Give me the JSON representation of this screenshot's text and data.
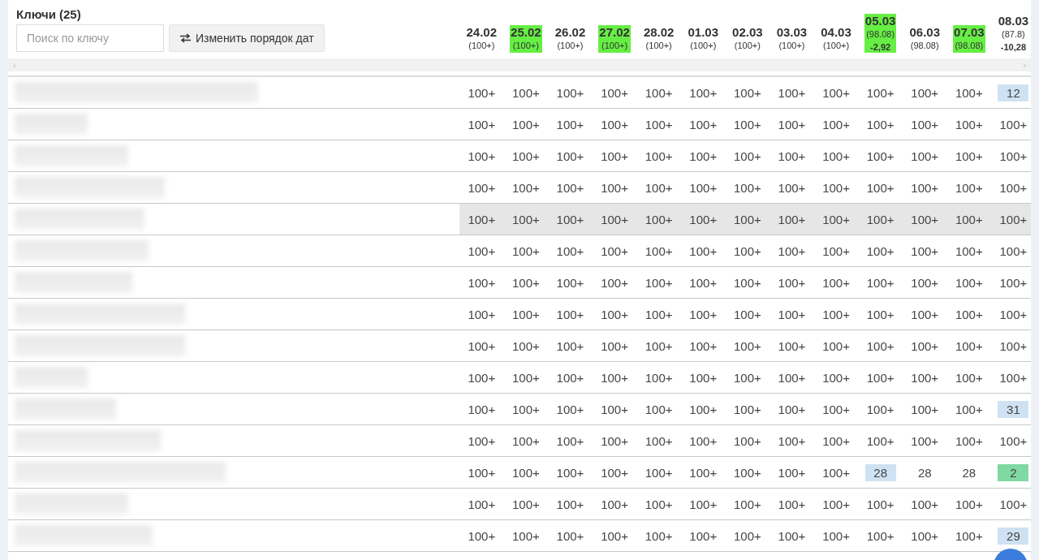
{
  "keys_panel": {
    "title": "Ключи (25)",
    "search": {
      "placeholder": "Поиск по ключу"
    },
    "reorder_button": {
      "label": "Изменить порядок дат"
    }
  },
  "dates": [
    {
      "date": "24.02",
      "sub": "(100+)",
      "highlighted": false
    },
    {
      "date": "25.02",
      "sub": "(100+)",
      "highlighted": true
    },
    {
      "date": "26.02",
      "sub": "(100+)",
      "highlighted": false
    },
    {
      "date": "27.02",
      "sub": "(100+)",
      "highlighted": true
    },
    {
      "date": "28.02",
      "sub": "(100+)",
      "highlighted": false
    },
    {
      "date": "01.03",
      "sub": "(100+)",
      "highlighted": false
    },
    {
      "date": "02.03",
      "sub": "(100+)",
      "highlighted": false
    },
    {
      "date": "03.03",
      "sub": "(100+)",
      "highlighted": false
    },
    {
      "date": "04.03",
      "sub": "(100+)",
      "highlighted": false
    },
    {
      "date": "05.03",
      "sub": "(98.08)",
      "delta": "-2,92",
      "highlighted": true
    },
    {
      "date": "06.03",
      "sub": "(98.08)",
      "highlighted": false
    },
    {
      "date": "07.03",
      "sub": "(98.08)",
      "highlighted": true
    },
    {
      "date": "08.03",
      "sub": "(87.8)",
      "delta": "-10,28",
      "highlighted": false
    }
  ],
  "scrollbar": {
    "left": "‹",
    "right": "›"
  },
  "rows": [
    {
      "hovered": false,
      "cells": [
        "100+",
        "100+",
        "100+",
        "100+",
        "100+",
        "100+",
        "100+",
        "100+",
        "100+",
        "100+",
        "100+",
        "100+",
        {
          "value": "12",
          "color": "#cfe2f3"
        }
      ]
    },
    {
      "hovered": false,
      "cells": [
        "100+",
        "100+",
        "100+",
        "100+",
        "100+",
        "100+",
        "100+",
        "100+",
        "100+",
        "100+",
        "100+",
        "100+",
        "100+"
      ]
    },
    {
      "hovered": false,
      "cells": [
        "100+",
        "100+",
        "100+",
        "100+",
        "100+",
        "100+",
        "100+",
        "100+",
        "100+",
        "100+",
        "100+",
        "100+",
        "100+"
      ]
    },
    {
      "hovered": false,
      "cells": [
        "100+",
        "100+",
        "100+",
        "100+",
        "100+",
        "100+",
        "100+",
        "100+",
        "100+",
        "100+",
        "100+",
        "100+",
        "100+"
      ]
    },
    {
      "hovered": true,
      "cells": [
        "100+",
        "100+",
        "100+",
        "100+",
        "100+",
        "100+",
        "100+",
        "100+",
        "100+",
        "100+",
        "100+",
        "100+",
        "100+"
      ]
    },
    {
      "hovered": false,
      "cells": [
        "100+",
        "100+",
        "100+",
        "100+",
        "100+",
        "100+",
        "100+",
        "100+",
        "100+",
        "100+",
        "100+",
        "100+",
        "100+"
      ]
    },
    {
      "hovered": false,
      "cells": [
        "100+",
        "100+",
        "100+",
        "100+",
        "100+",
        "100+",
        "100+",
        "100+",
        "100+",
        "100+",
        "100+",
        "100+",
        "100+"
      ]
    },
    {
      "hovered": false,
      "cells": [
        "100+",
        "100+",
        "100+",
        "100+",
        "100+",
        "100+",
        "100+",
        "100+",
        "100+",
        "100+",
        "100+",
        "100+",
        "100+"
      ]
    },
    {
      "hovered": false,
      "cells": [
        "100+",
        "100+",
        "100+",
        "100+",
        "100+",
        "100+",
        "100+",
        "100+",
        "100+",
        "100+",
        "100+",
        "100+",
        "100+"
      ]
    },
    {
      "hovered": false,
      "cells": [
        "100+",
        "100+",
        "100+",
        "100+",
        "100+",
        "100+",
        "100+",
        "100+",
        "100+",
        "100+",
        "100+",
        "100+",
        "100+"
      ]
    },
    {
      "hovered": false,
      "cells": [
        "100+",
        "100+",
        "100+",
        "100+",
        "100+",
        "100+",
        "100+",
        "100+",
        "100+",
        "100+",
        "100+",
        "100+",
        {
          "value": "31",
          "color": "#cfe2f3"
        }
      ]
    },
    {
      "hovered": false,
      "cells": [
        "100+",
        "100+",
        "100+",
        "100+",
        "100+",
        "100+",
        "100+",
        "100+",
        "100+",
        "100+",
        "100+",
        "100+",
        "100+"
      ]
    },
    {
      "hovered": false,
      "cells": [
        "100+",
        "100+",
        "100+",
        "100+",
        "100+",
        "100+",
        "100+",
        "100+",
        "100+",
        {
          "value": "28",
          "color": "#cfe2f3"
        },
        "28",
        "28",
        {
          "value": "2",
          "color": "#80d8a2"
        }
      ]
    },
    {
      "hovered": false,
      "cells": [
        "100+",
        "100+",
        "100+",
        "100+",
        "100+",
        "100+",
        "100+",
        "100+",
        "100+",
        "100+",
        "100+",
        "100+",
        "100+"
      ]
    },
    {
      "hovered": false,
      "cells": [
        "100+",
        "100+",
        "100+",
        "100+",
        "100+",
        "100+",
        "100+",
        "100+",
        "100+",
        "100+",
        "100+",
        "100+",
        {
          "value": "29",
          "color": "#cfe2f3"
        }
      ]
    }
  ]
}
